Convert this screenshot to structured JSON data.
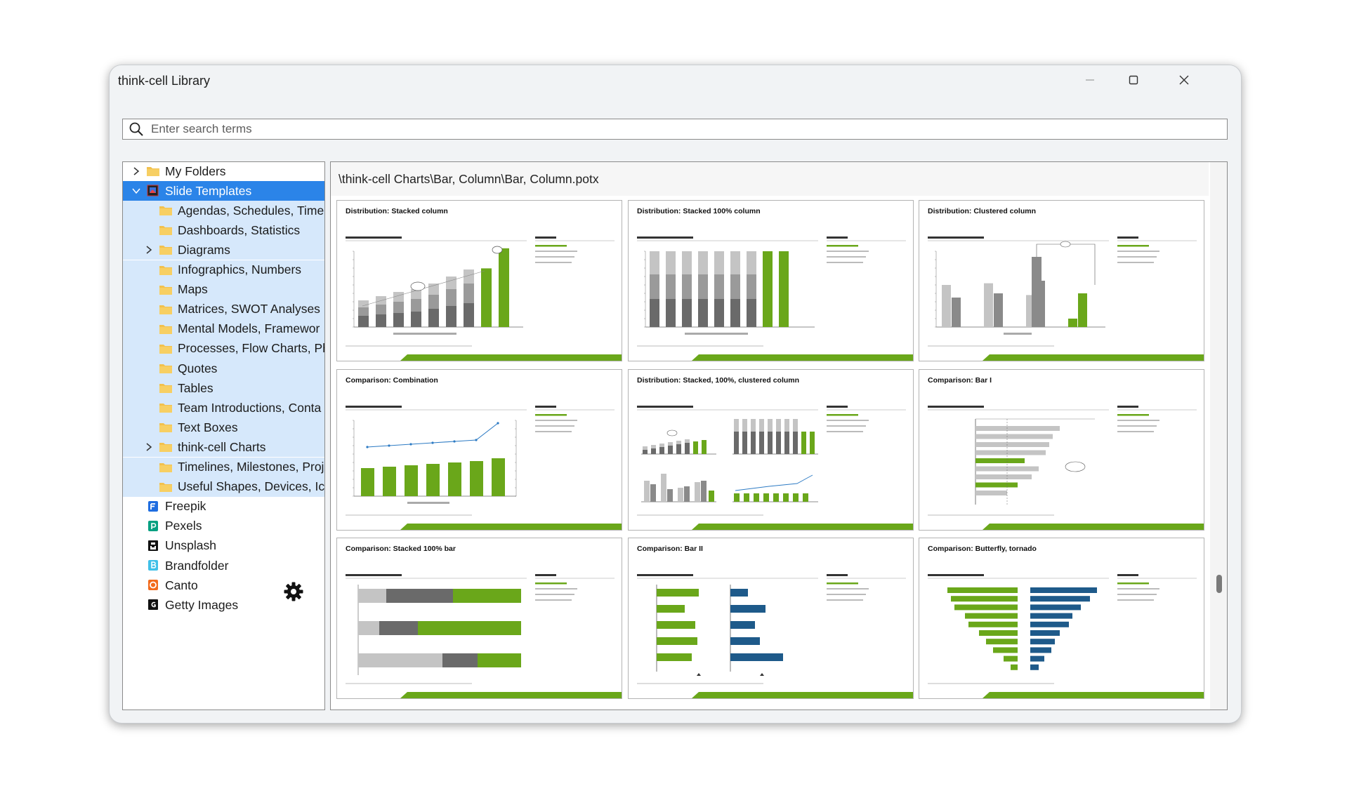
{
  "window": {
    "title": "think-cell Library"
  },
  "search": {
    "placeholder": "Enter search terms"
  },
  "tree": [
    {
      "label": "My Folders",
      "level": 0,
      "expander": "collapsed",
      "icon": "folder-icon",
      "selected": false,
      "highlight": false
    },
    {
      "label": "Slide Templates",
      "level": 0,
      "expander": "expanded",
      "icon": "slide-templates-icon",
      "selected": true,
      "highlight": false
    },
    {
      "label": "Agendas, Schedules, Time",
      "level": 1,
      "expander": "none",
      "icon": "folder-icon",
      "selected": false,
      "highlight": true
    },
    {
      "label": "Dashboards, Statistics",
      "level": 1,
      "expander": "none",
      "icon": "folder-icon",
      "selected": false,
      "highlight": true
    },
    {
      "label": "Diagrams",
      "level": 1,
      "expander": "collapsed",
      "icon": "folder-icon",
      "selected": false,
      "highlight": true
    },
    {
      "label": "Infographics, Numbers",
      "level": 1,
      "expander": "none",
      "icon": "folder-icon",
      "selected": false,
      "highlight": true
    },
    {
      "label": "Maps",
      "level": 1,
      "expander": "none",
      "icon": "folder-icon",
      "selected": false,
      "highlight": true
    },
    {
      "label": "Matrices, SWOT Analyses",
      "level": 1,
      "expander": "none",
      "icon": "folder-icon",
      "selected": false,
      "highlight": true
    },
    {
      "label": "Mental Models, Framewor",
      "level": 1,
      "expander": "none",
      "icon": "folder-icon",
      "selected": false,
      "highlight": true
    },
    {
      "label": "Processes, Flow Charts, Ph",
      "level": 1,
      "expander": "none",
      "icon": "folder-icon",
      "selected": false,
      "highlight": true
    },
    {
      "label": "Quotes",
      "level": 1,
      "expander": "none",
      "icon": "folder-icon",
      "selected": false,
      "highlight": true
    },
    {
      "label": "Tables",
      "level": 1,
      "expander": "none",
      "icon": "folder-icon",
      "selected": false,
      "highlight": true
    },
    {
      "label": "Team Introductions, Conta",
      "level": 1,
      "expander": "none",
      "icon": "folder-icon",
      "selected": false,
      "highlight": true
    },
    {
      "label": "Text Boxes",
      "level": 1,
      "expander": "none",
      "icon": "folder-icon",
      "selected": false,
      "highlight": true
    },
    {
      "label": "think-cell Charts",
      "level": 1,
      "expander": "collapsed",
      "icon": "folder-icon",
      "selected": false,
      "highlight": true
    },
    {
      "label": "Timelines, Milestones, Proj",
      "level": 1,
      "expander": "none",
      "icon": "folder-icon",
      "selected": false,
      "highlight": true
    },
    {
      "label": "Useful Shapes, Devices, Ic",
      "level": 1,
      "expander": "none",
      "icon": "folder-icon",
      "selected": false,
      "highlight": true
    },
    {
      "label": "Freepik",
      "level": 0,
      "expander": "none",
      "icon": "freepik-icon",
      "selected": false,
      "highlight": false
    },
    {
      "label": "Pexels",
      "level": 0,
      "expander": "none",
      "icon": "pexels-icon",
      "selected": false,
      "highlight": false
    },
    {
      "label": "Unsplash",
      "level": 0,
      "expander": "none",
      "icon": "unsplash-icon",
      "selected": false,
      "highlight": false
    },
    {
      "label": "Brandfolder",
      "level": 0,
      "expander": "none",
      "icon": "brandfolder-icon",
      "selected": false,
      "highlight": false
    },
    {
      "label": "Canto",
      "level": 0,
      "expander": "none",
      "icon": "canto-icon",
      "selected": false,
      "highlight": false
    },
    {
      "label": "Getty Images",
      "level": 0,
      "expander": "none",
      "icon": "getty-images-icon",
      "selected": false,
      "highlight": false
    }
  ],
  "content": {
    "path": "\\think-cell Charts\\Bar, Column\\Bar, Column.potx",
    "templates": [
      {
        "title": "Distribution: Stacked column",
        "kind": "stacked-column"
      },
      {
        "title": "Distribution: Stacked 100% column",
        "kind": "stacked-100-column"
      },
      {
        "title": "Distribution: Clustered column",
        "kind": "clustered-column"
      },
      {
        "title": "Comparison: Combination",
        "kind": "combination"
      },
      {
        "title": "Distribution: Stacked, 100%, clustered column",
        "kind": "multi"
      },
      {
        "title": "Comparison: Bar I",
        "kind": "bar-1"
      },
      {
        "title": "Comparison: Stacked 100% bar",
        "kind": "stacked-100-bar"
      },
      {
        "title": "Comparison: Bar II",
        "kind": "bar-2"
      },
      {
        "title": "Comparison: Butterfly, tornado",
        "kind": "butterfly"
      }
    ]
  },
  "colors": {
    "accent": "#2b84e8",
    "tree_highlight": "#d6e8fb",
    "chart_green": "#6aa71a",
    "chart_dark": "#6a6a6a",
    "chart_light": "#c4c4c4",
    "chart_blue": "#1e5a8a"
  }
}
